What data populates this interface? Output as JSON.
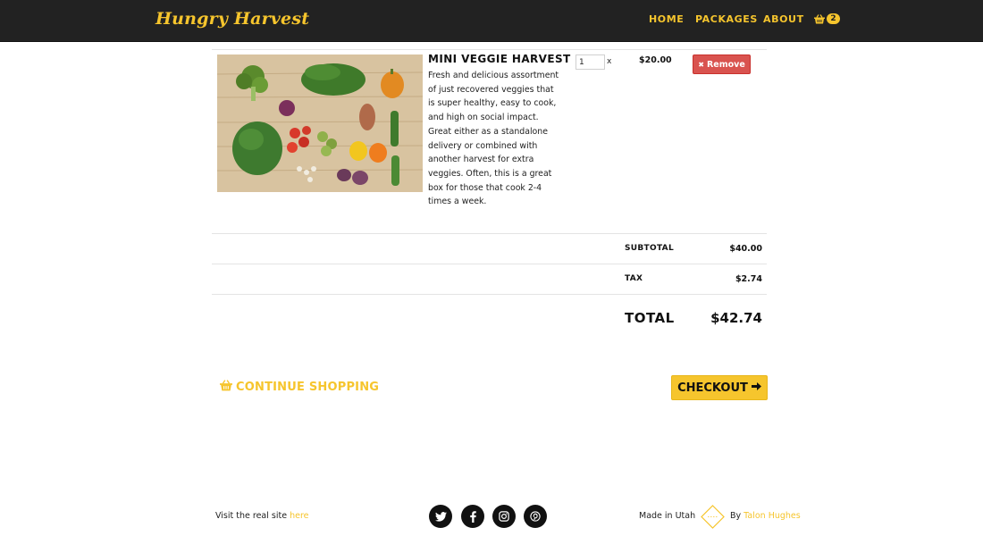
{
  "navbar": {
    "brand": "Hungry Harvest",
    "links": [
      {
        "label": "HOME"
      },
      {
        "label": "PACKAGES"
      },
      {
        "label": "ABOUT"
      }
    ],
    "cart_count": "2",
    "cart_icon": "basket-icon"
  },
  "cart": {
    "item": {
      "name": "MINI VEGGIE HARVEST",
      "description": "Fresh and delicious assortment of just recovered veggies that is super healthy, easy to cook, and high on social impact. Great either as a standalone delivery or combined with another harvest for extra veggies. Often, this is a great box for those that cook 2-4 times a week.",
      "quantity": "1",
      "qty_multiplier": "x",
      "unit_price": "$20.00",
      "remove_label": "Remove",
      "remove_icon": "close-icon"
    },
    "summary": {
      "subtotal_label": "SUBTOTAL",
      "subtotal_value": "$40.00",
      "tax_label": "TAX",
      "tax_value": "$2.74",
      "total_label": "TOTAL",
      "total_value": "$42.74"
    }
  },
  "actions": {
    "continue_label": "CONTINUE SHOPPING",
    "continue_icon": "basket-icon",
    "checkout_label": "CHECKOUT",
    "checkout_icon": "arrow-right-icon"
  },
  "footer": {
    "visit_text": "Visit the real site",
    "visit_link": "here",
    "social": [
      "twitter-icon",
      "facebook-icon",
      "instagram-icon",
      "pinterest-icon"
    ],
    "made_in": "Made in Utah",
    "by_text": "By",
    "author": "Talon Hughes"
  },
  "colors": {
    "accent": "#f6c52d",
    "navbar_bg": "#222222",
    "danger": "#d9534f"
  }
}
